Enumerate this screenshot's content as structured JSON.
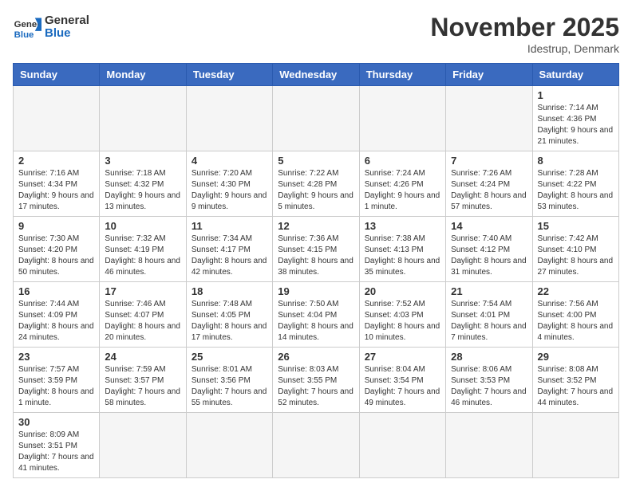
{
  "header": {
    "logo_general": "General",
    "logo_blue": "Blue",
    "month_title": "November 2025",
    "location": "Idestrup, Denmark"
  },
  "days_of_week": [
    "Sunday",
    "Monday",
    "Tuesday",
    "Wednesday",
    "Thursday",
    "Friday",
    "Saturday"
  ],
  "weeks": [
    [
      {
        "day": "",
        "info": ""
      },
      {
        "day": "",
        "info": ""
      },
      {
        "day": "",
        "info": ""
      },
      {
        "day": "",
        "info": ""
      },
      {
        "day": "",
        "info": ""
      },
      {
        "day": "",
        "info": ""
      },
      {
        "day": "1",
        "info": "Sunrise: 7:14 AM\nSunset: 4:36 PM\nDaylight: 9 hours and 21 minutes."
      }
    ],
    [
      {
        "day": "2",
        "info": "Sunrise: 7:16 AM\nSunset: 4:34 PM\nDaylight: 9 hours and 17 minutes."
      },
      {
        "day": "3",
        "info": "Sunrise: 7:18 AM\nSunset: 4:32 PM\nDaylight: 9 hours and 13 minutes."
      },
      {
        "day": "4",
        "info": "Sunrise: 7:20 AM\nSunset: 4:30 PM\nDaylight: 9 hours and 9 minutes."
      },
      {
        "day": "5",
        "info": "Sunrise: 7:22 AM\nSunset: 4:28 PM\nDaylight: 9 hours and 5 minutes."
      },
      {
        "day": "6",
        "info": "Sunrise: 7:24 AM\nSunset: 4:26 PM\nDaylight: 9 hours and 1 minute."
      },
      {
        "day": "7",
        "info": "Sunrise: 7:26 AM\nSunset: 4:24 PM\nDaylight: 8 hours and 57 minutes."
      },
      {
        "day": "8",
        "info": "Sunrise: 7:28 AM\nSunset: 4:22 PM\nDaylight: 8 hours and 53 minutes."
      }
    ],
    [
      {
        "day": "9",
        "info": "Sunrise: 7:30 AM\nSunset: 4:20 PM\nDaylight: 8 hours and 50 minutes."
      },
      {
        "day": "10",
        "info": "Sunrise: 7:32 AM\nSunset: 4:19 PM\nDaylight: 8 hours and 46 minutes."
      },
      {
        "day": "11",
        "info": "Sunrise: 7:34 AM\nSunset: 4:17 PM\nDaylight: 8 hours and 42 minutes."
      },
      {
        "day": "12",
        "info": "Sunrise: 7:36 AM\nSunset: 4:15 PM\nDaylight: 8 hours and 38 minutes."
      },
      {
        "day": "13",
        "info": "Sunrise: 7:38 AM\nSunset: 4:13 PM\nDaylight: 8 hours and 35 minutes."
      },
      {
        "day": "14",
        "info": "Sunrise: 7:40 AM\nSunset: 4:12 PM\nDaylight: 8 hours and 31 minutes."
      },
      {
        "day": "15",
        "info": "Sunrise: 7:42 AM\nSunset: 4:10 PM\nDaylight: 8 hours and 27 minutes."
      }
    ],
    [
      {
        "day": "16",
        "info": "Sunrise: 7:44 AM\nSunset: 4:09 PM\nDaylight: 8 hours and 24 minutes."
      },
      {
        "day": "17",
        "info": "Sunrise: 7:46 AM\nSunset: 4:07 PM\nDaylight: 8 hours and 20 minutes."
      },
      {
        "day": "18",
        "info": "Sunrise: 7:48 AM\nSunset: 4:05 PM\nDaylight: 8 hours and 17 minutes."
      },
      {
        "day": "19",
        "info": "Sunrise: 7:50 AM\nSunset: 4:04 PM\nDaylight: 8 hours and 14 minutes."
      },
      {
        "day": "20",
        "info": "Sunrise: 7:52 AM\nSunset: 4:03 PM\nDaylight: 8 hours and 10 minutes."
      },
      {
        "day": "21",
        "info": "Sunrise: 7:54 AM\nSunset: 4:01 PM\nDaylight: 8 hours and 7 minutes."
      },
      {
        "day": "22",
        "info": "Sunrise: 7:56 AM\nSunset: 4:00 PM\nDaylight: 8 hours and 4 minutes."
      }
    ],
    [
      {
        "day": "23",
        "info": "Sunrise: 7:57 AM\nSunset: 3:59 PM\nDaylight: 8 hours and 1 minute."
      },
      {
        "day": "24",
        "info": "Sunrise: 7:59 AM\nSunset: 3:57 PM\nDaylight: 7 hours and 58 minutes."
      },
      {
        "day": "25",
        "info": "Sunrise: 8:01 AM\nSunset: 3:56 PM\nDaylight: 7 hours and 55 minutes."
      },
      {
        "day": "26",
        "info": "Sunrise: 8:03 AM\nSunset: 3:55 PM\nDaylight: 7 hours and 52 minutes."
      },
      {
        "day": "27",
        "info": "Sunrise: 8:04 AM\nSunset: 3:54 PM\nDaylight: 7 hours and 49 minutes."
      },
      {
        "day": "28",
        "info": "Sunrise: 8:06 AM\nSunset: 3:53 PM\nDaylight: 7 hours and 46 minutes."
      },
      {
        "day": "29",
        "info": "Sunrise: 8:08 AM\nSunset: 3:52 PM\nDaylight: 7 hours and 44 minutes."
      }
    ],
    [
      {
        "day": "30",
        "info": "Sunrise: 8:09 AM\nSunset: 3:51 PM\nDaylight: 7 hours and 41 minutes."
      },
      {
        "day": "",
        "info": ""
      },
      {
        "day": "",
        "info": ""
      },
      {
        "day": "",
        "info": ""
      },
      {
        "day": "",
        "info": ""
      },
      {
        "day": "",
        "info": ""
      },
      {
        "day": "",
        "info": ""
      }
    ]
  ]
}
